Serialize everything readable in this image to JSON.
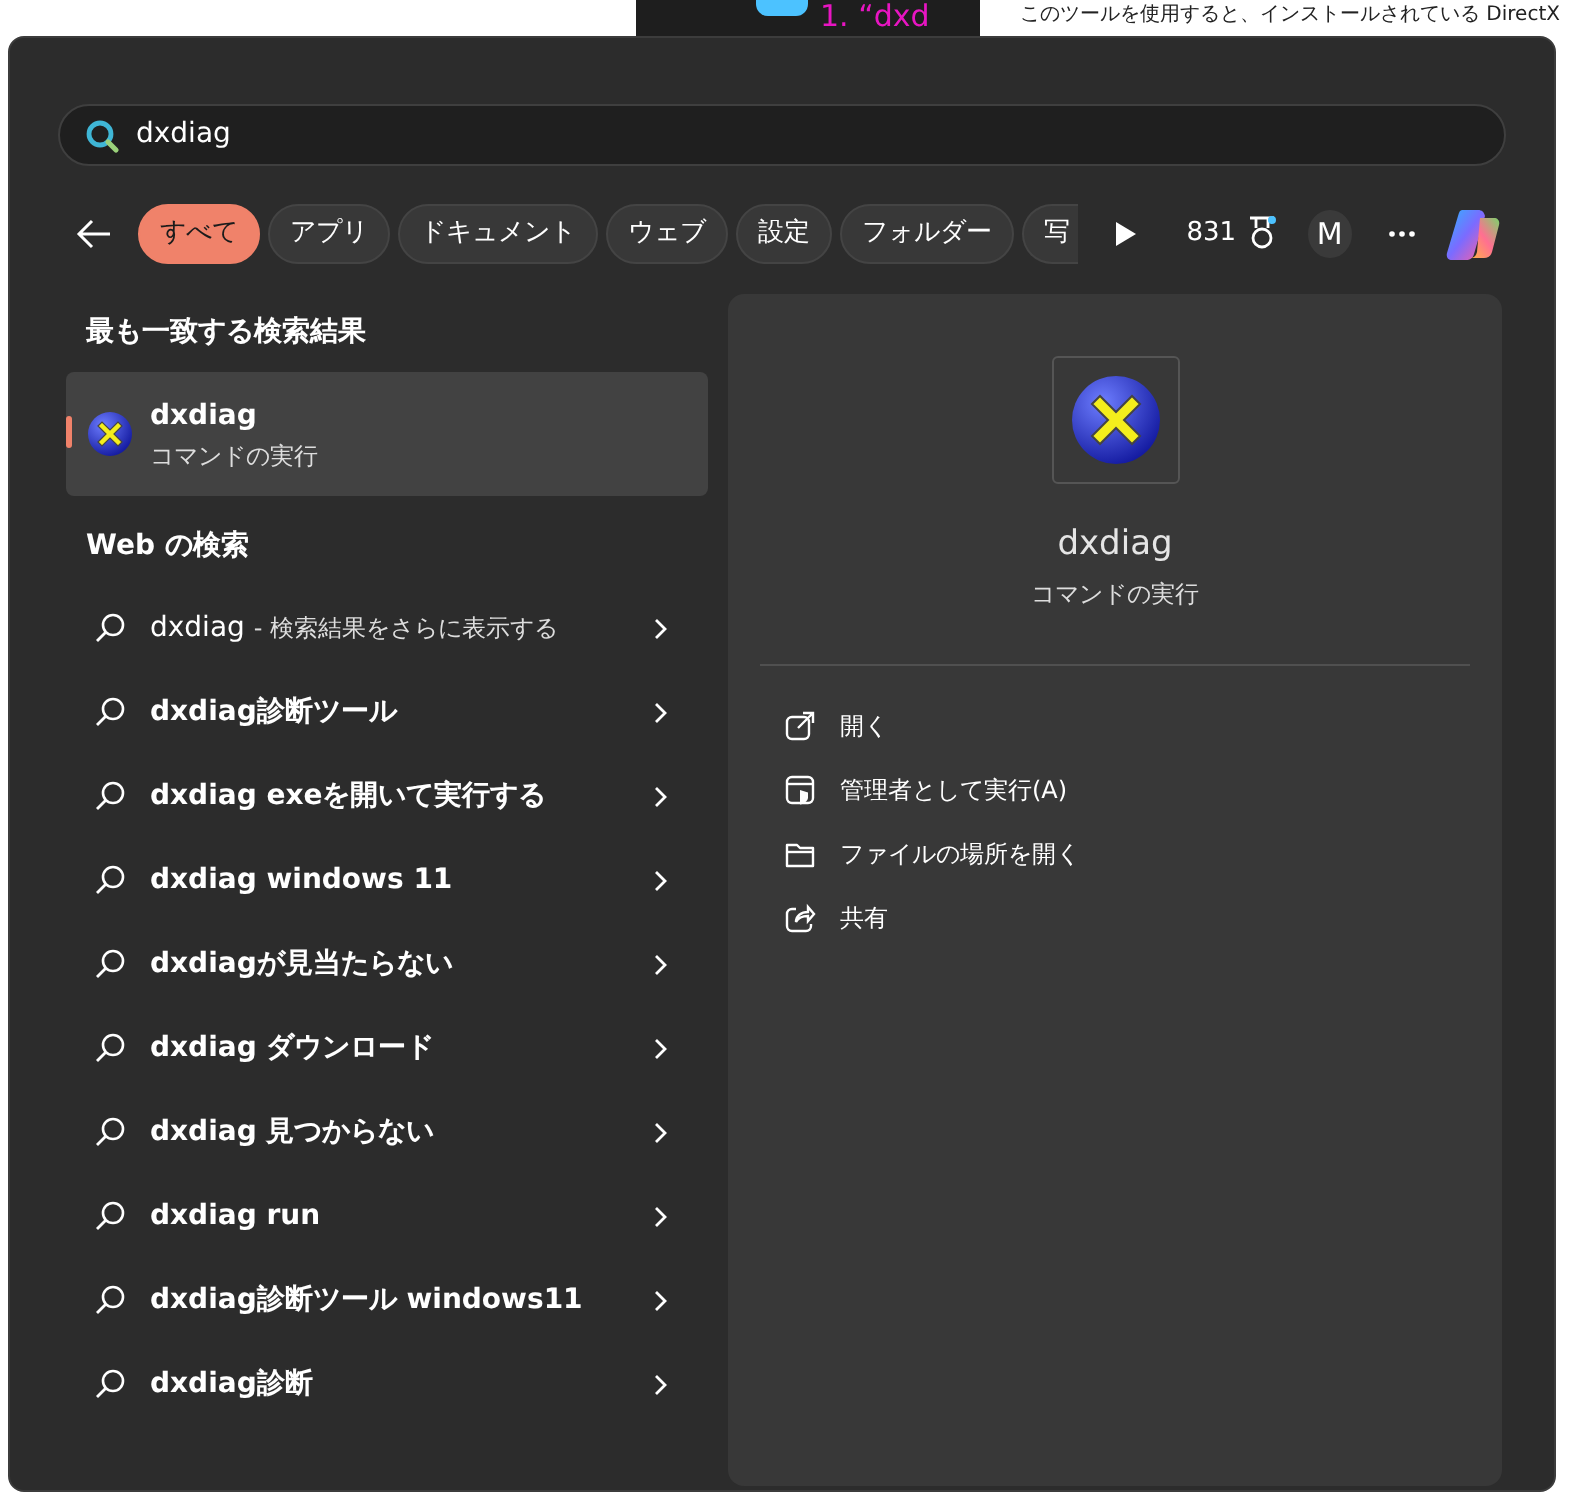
{
  "background": {
    "heading": "1. “dxd",
    "sentence": "このツールを使用すると、インストールされている DirectX"
  },
  "search": {
    "value": "dxdiag"
  },
  "filters": [
    {
      "label": "すべて",
      "selected": true
    },
    {
      "label": "アプリ",
      "selected": false
    },
    {
      "label": "ドキュメント",
      "selected": false
    },
    {
      "label": "ウェブ",
      "selected": false
    },
    {
      "label": "設定",
      "selected": false
    },
    {
      "label": "フォルダー",
      "selected": false
    },
    {
      "label": "写",
      "selected": false
    }
  ],
  "points": "831",
  "avatar": "M",
  "best_match": {
    "heading": "最も一致する検索結果",
    "title": "dxdiag",
    "subtitle": "コマンドの実行"
  },
  "web": {
    "heading": "Web の検索",
    "results": [
      {
        "kind": "more",
        "text": "dxdiag",
        "hint": "- 検索結果をさらに表示する"
      },
      {
        "kind": "suggestion",
        "text": "dxdiag診断ツール"
      },
      {
        "kind": "suggestion",
        "text": "dxdiag exeを開いて実行する"
      },
      {
        "kind": "suggestion",
        "text": "dxdiag windows 11"
      },
      {
        "kind": "suggestion",
        "text": "dxdiagが見当たらない"
      },
      {
        "kind": "suggestion",
        "text": "dxdiag ダウンロード"
      },
      {
        "kind": "suggestion",
        "text": "dxdiag 見つからない"
      },
      {
        "kind": "suggestion",
        "text": "dxdiag run"
      },
      {
        "kind": "suggestion",
        "text": "dxdiag診断ツール windows11"
      },
      {
        "kind": "suggestion",
        "text": "dxdiag診断"
      }
    ]
  },
  "detail": {
    "title": "dxdiag",
    "subtitle": "コマンドの実行",
    "actions": [
      {
        "kind": "open",
        "label": "開く"
      },
      {
        "kind": "admin",
        "label": "管理者として実行(A)"
      },
      {
        "kind": "folder",
        "label": "ファイルの場所を開く"
      },
      {
        "kind": "share",
        "label": "共有"
      }
    ]
  }
}
